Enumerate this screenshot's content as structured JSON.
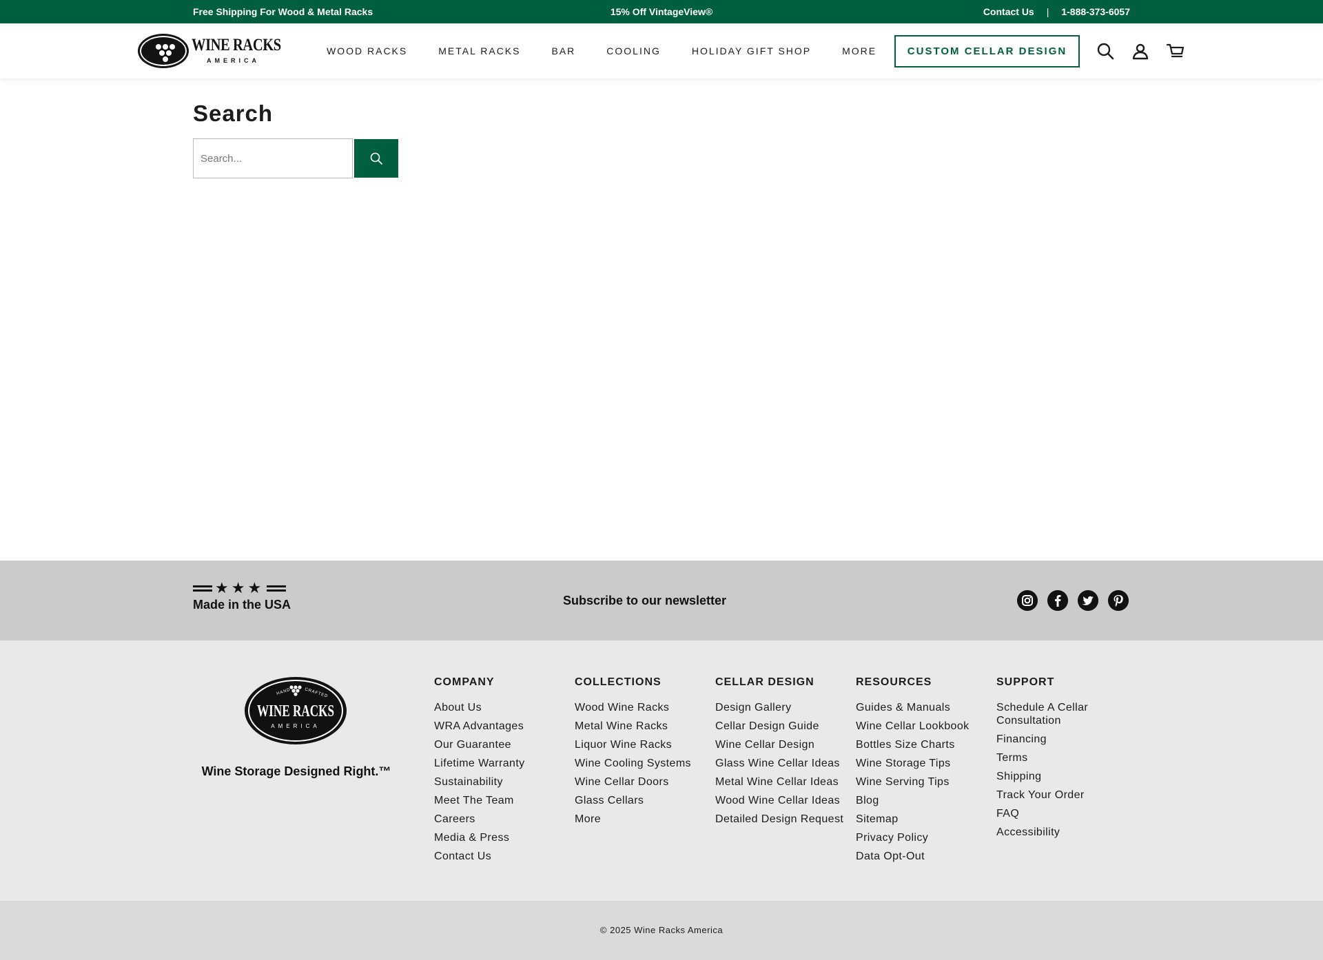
{
  "announcement": {
    "left": "Free Shipping For Wood & Metal Racks",
    "center": "15% Off VintageView®",
    "contact": "Contact Us",
    "separator": "|",
    "phone": "1-888-373-6057"
  },
  "logo": {
    "word1": "WINE RACKS",
    "word2": "AMERICA"
  },
  "nav": {
    "items": [
      "WOOD RACKS",
      "METAL RACKS",
      "BAR",
      "COOLING",
      "HOLIDAY GIFT SHOP",
      "MORE"
    ],
    "cta": "CUSTOM CELLAR DESIGN",
    "icons": [
      "search-icon",
      "account-icon",
      "cart-icon"
    ]
  },
  "main": {
    "title": "Search",
    "search_placeholder": "Search...",
    "search_value": ""
  },
  "band": {
    "made_in": "Made in the USA",
    "stars": "★★★",
    "newsletter": "Subscribe to our newsletter",
    "socials": [
      "instagram-icon",
      "facebook-icon",
      "twitter-icon",
      "pinterest-icon"
    ]
  },
  "footer": {
    "logo_top": "HAND CRAFTED",
    "logo_main": "WINE RACKS",
    "logo_bottom": "AMERICA",
    "tagline": "Wine Storage Designed Right.™",
    "columns": [
      {
        "title": "COMPANY",
        "links": [
          "About Us",
          "WRA Advantages",
          "Our Guarantee",
          "Lifetime Warranty",
          "Sustainability",
          "Meet The Team",
          "Careers",
          "Media & Press",
          "Contact Us"
        ]
      },
      {
        "title": "COLLECTIONS",
        "links": [
          "Wood Wine Racks",
          "Metal Wine Racks",
          "Liquor Wine Racks",
          "Wine Cooling Systems",
          "Wine Cellar Doors",
          "Glass Cellars",
          "More"
        ]
      },
      {
        "title": "CELLAR DESIGN",
        "links": [
          "Design Gallery",
          "Cellar Design Guide",
          "Wine Cellar Design",
          "Glass Wine Cellar Ideas",
          "Metal Wine Cellar Ideas",
          "Wood Wine Cellar Ideas",
          "Detailed Design Request"
        ]
      },
      {
        "title": "RESOURCES",
        "links": [
          "Guides & Manuals",
          "Wine Cellar Lookbook",
          "Bottles Size Charts",
          "Wine Storage Tips",
          "Wine Serving Tips",
          "Blog",
          "Sitemap",
          "Privacy Policy",
          "Data Opt-Out"
        ]
      },
      {
        "title": "SUPPORT",
        "links": [
          "Schedule A Cellar Consultation",
          "Financing",
          "Terms",
          "Shipping",
          "Track Your Order",
          "FAQ",
          "Accessibility"
        ]
      }
    ],
    "copyright": "© 2025 Wine Racks America"
  },
  "colors": {
    "brand_green": "#005f3f",
    "band_gray": "#cbcbcb",
    "footer_gray": "#e9e9e9",
    "bottom_gray": "#dadada"
  }
}
